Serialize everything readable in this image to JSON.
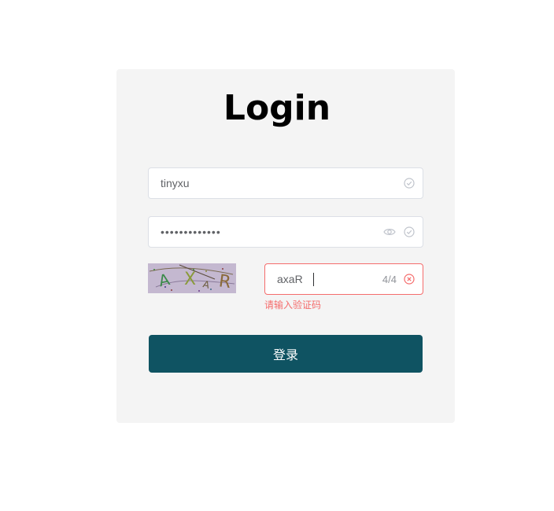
{
  "login": {
    "title": "Login",
    "username": {
      "value": "tinyxu"
    },
    "password": {
      "value": "•••••••••••••"
    },
    "captcha": {
      "image_text": "AXAR",
      "value": "axaR",
      "counter": "4/4",
      "error": "请输入验证码"
    },
    "submit_label": "登录"
  },
  "colors": {
    "card_bg": "#f4f4f4",
    "primary": "#0f5362",
    "error": "#f56c6c",
    "border": "#dcdfe6"
  }
}
